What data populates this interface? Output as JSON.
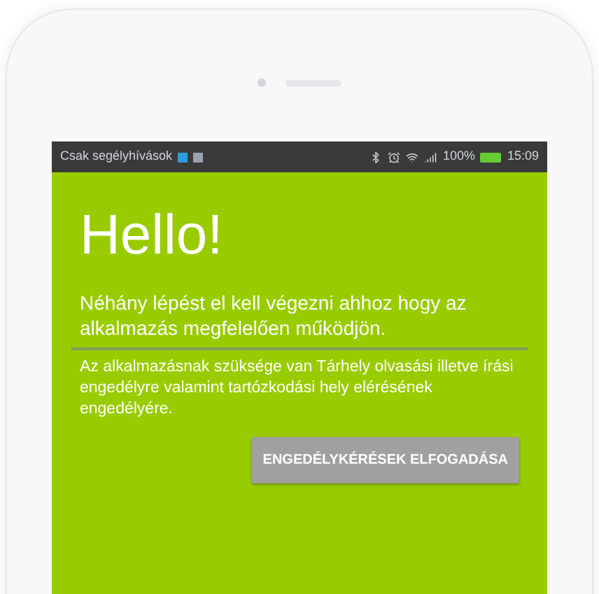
{
  "status_bar": {
    "carrier": "Csak segélyhívások",
    "battery_percent": "100%",
    "time": "15:09"
  },
  "screen": {
    "title": "Hello!",
    "intro": "Néhány lépést el kell végezni ahhoz hogy az alkalmazás megfelelően működjön.",
    "description": "Az alkalmazásnak szüksége van Tárhely olvasási illetve írási engedélyre valamint tartózkodási hely elérésének engedélyére.",
    "button": "ENGEDÉLYKÉRÉSEK ELFOGADÁSA"
  }
}
